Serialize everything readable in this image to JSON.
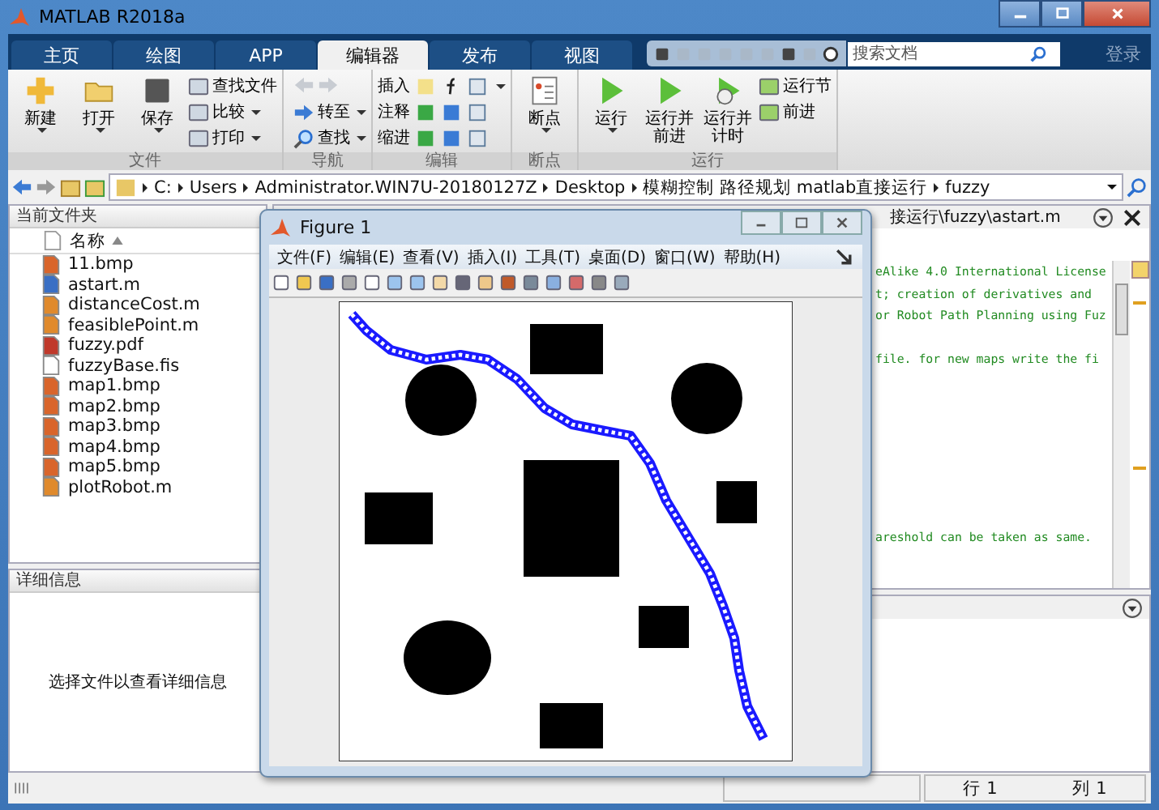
{
  "window": {
    "title": "MATLAB R2018a"
  },
  "tabs": [
    {
      "label": "主页",
      "selected": false
    },
    {
      "label": "绘图",
      "selected": false
    },
    {
      "label": "APP",
      "selected": false
    },
    {
      "label": "编辑器",
      "selected": true
    },
    {
      "label": "发布",
      "selected": false
    },
    {
      "label": "视图",
      "selected": false
    }
  ],
  "search": {
    "placeholder": "搜索文档"
  },
  "login": "登录",
  "toolstrip": [
    {
      "kind": "file",
      "label": "文件",
      "big": [
        {
          "label": "新建",
          "dropdown": true
        },
        {
          "label": "打开",
          "dropdown": true
        },
        {
          "label": "保存",
          "dropdown": true
        }
      ],
      "small": [
        {
          "label": "查找文件",
          "dropdown": false
        },
        {
          "label": "比较",
          "dropdown": true
        },
        {
          "label": "打印",
          "dropdown": true
        }
      ]
    },
    {
      "kind": "nav",
      "label": "导航",
      "small": [
        {
          "label": "转至",
          "dropdown": true
        },
        {
          "label": "查找",
          "dropdown": true
        }
      ]
    },
    {
      "kind": "edit",
      "label": "编辑",
      "small": [
        {
          "label": "插入",
          "dropdown": true
        },
        {
          "label": "注释",
          "dropdown": false
        },
        {
          "label": "缩进",
          "dropdown": false
        }
      ]
    },
    {
      "kind": "breakpoint",
      "label": "断点",
      "big": [
        {
          "label": "断点",
          "dropdown": true
        }
      ]
    },
    {
      "kind": "run",
      "label": "运行",
      "big": [
        {
          "label": "运行",
          "dropdown": true
        },
        {
          "label": "运行并前进",
          "dropdown": false
        },
        {
          "label": "运行并计时",
          "dropdown": false
        }
      ],
      "small": [
        {
          "label": "运行节",
          "dropdown": false
        },
        {
          "label": "前进",
          "dropdown": false
        }
      ]
    }
  ],
  "address": [
    "C:",
    "Users",
    "Administrator.WIN7U-20180127Z",
    "Desktop",
    "模糊控制 路径规划 matlab直接运行",
    "fuzzy"
  ],
  "current_folder": {
    "title": "当前文件夹",
    "column": "名称",
    "files": [
      {
        "name": "11.bmp",
        "kind": "bmp"
      },
      {
        "name": "astart.m",
        "kind": "script"
      },
      {
        "name": "distanceCost.m",
        "kind": "function"
      },
      {
        "name": "feasiblePoint.m",
        "kind": "function"
      },
      {
        "name": "fuzzy.pdf",
        "kind": "pdf"
      },
      {
        "name": "fuzzyBase.fis",
        "kind": "file"
      },
      {
        "name": "map1.bmp",
        "kind": "bmp"
      },
      {
        "name": "map2.bmp",
        "kind": "bmp"
      },
      {
        "name": "map3.bmp",
        "kind": "bmp"
      },
      {
        "name": "map4.bmp",
        "kind": "bmp"
      },
      {
        "name": "map5.bmp",
        "kind": "bmp"
      },
      {
        "name": "plotRobot.m",
        "kind": "function"
      }
    ]
  },
  "details": {
    "title": "详细信息",
    "message": "选择文件以查看详细信息"
  },
  "editor": {
    "path": "接运行\\fuzzy\\astart.m",
    "lines": [
      "eAlike 4.0 International License",
      "t; creation of derivatives and",
      "or Robot Path Planning using Fuz",
      "file. for new maps write the fi",
      "areshold can be taken as same."
    ]
  },
  "figure": {
    "title": "Figure 1",
    "menu": [
      "文件(F)",
      "编辑(E)",
      "查看(V)",
      "插入(I)",
      "工具(T)",
      "桌面(D)",
      "窗口(W)",
      "帮助(H)"
    ]
  },
  "status_bar": {
    "row": "行 1",
    "column": "列 1"
  }
}
